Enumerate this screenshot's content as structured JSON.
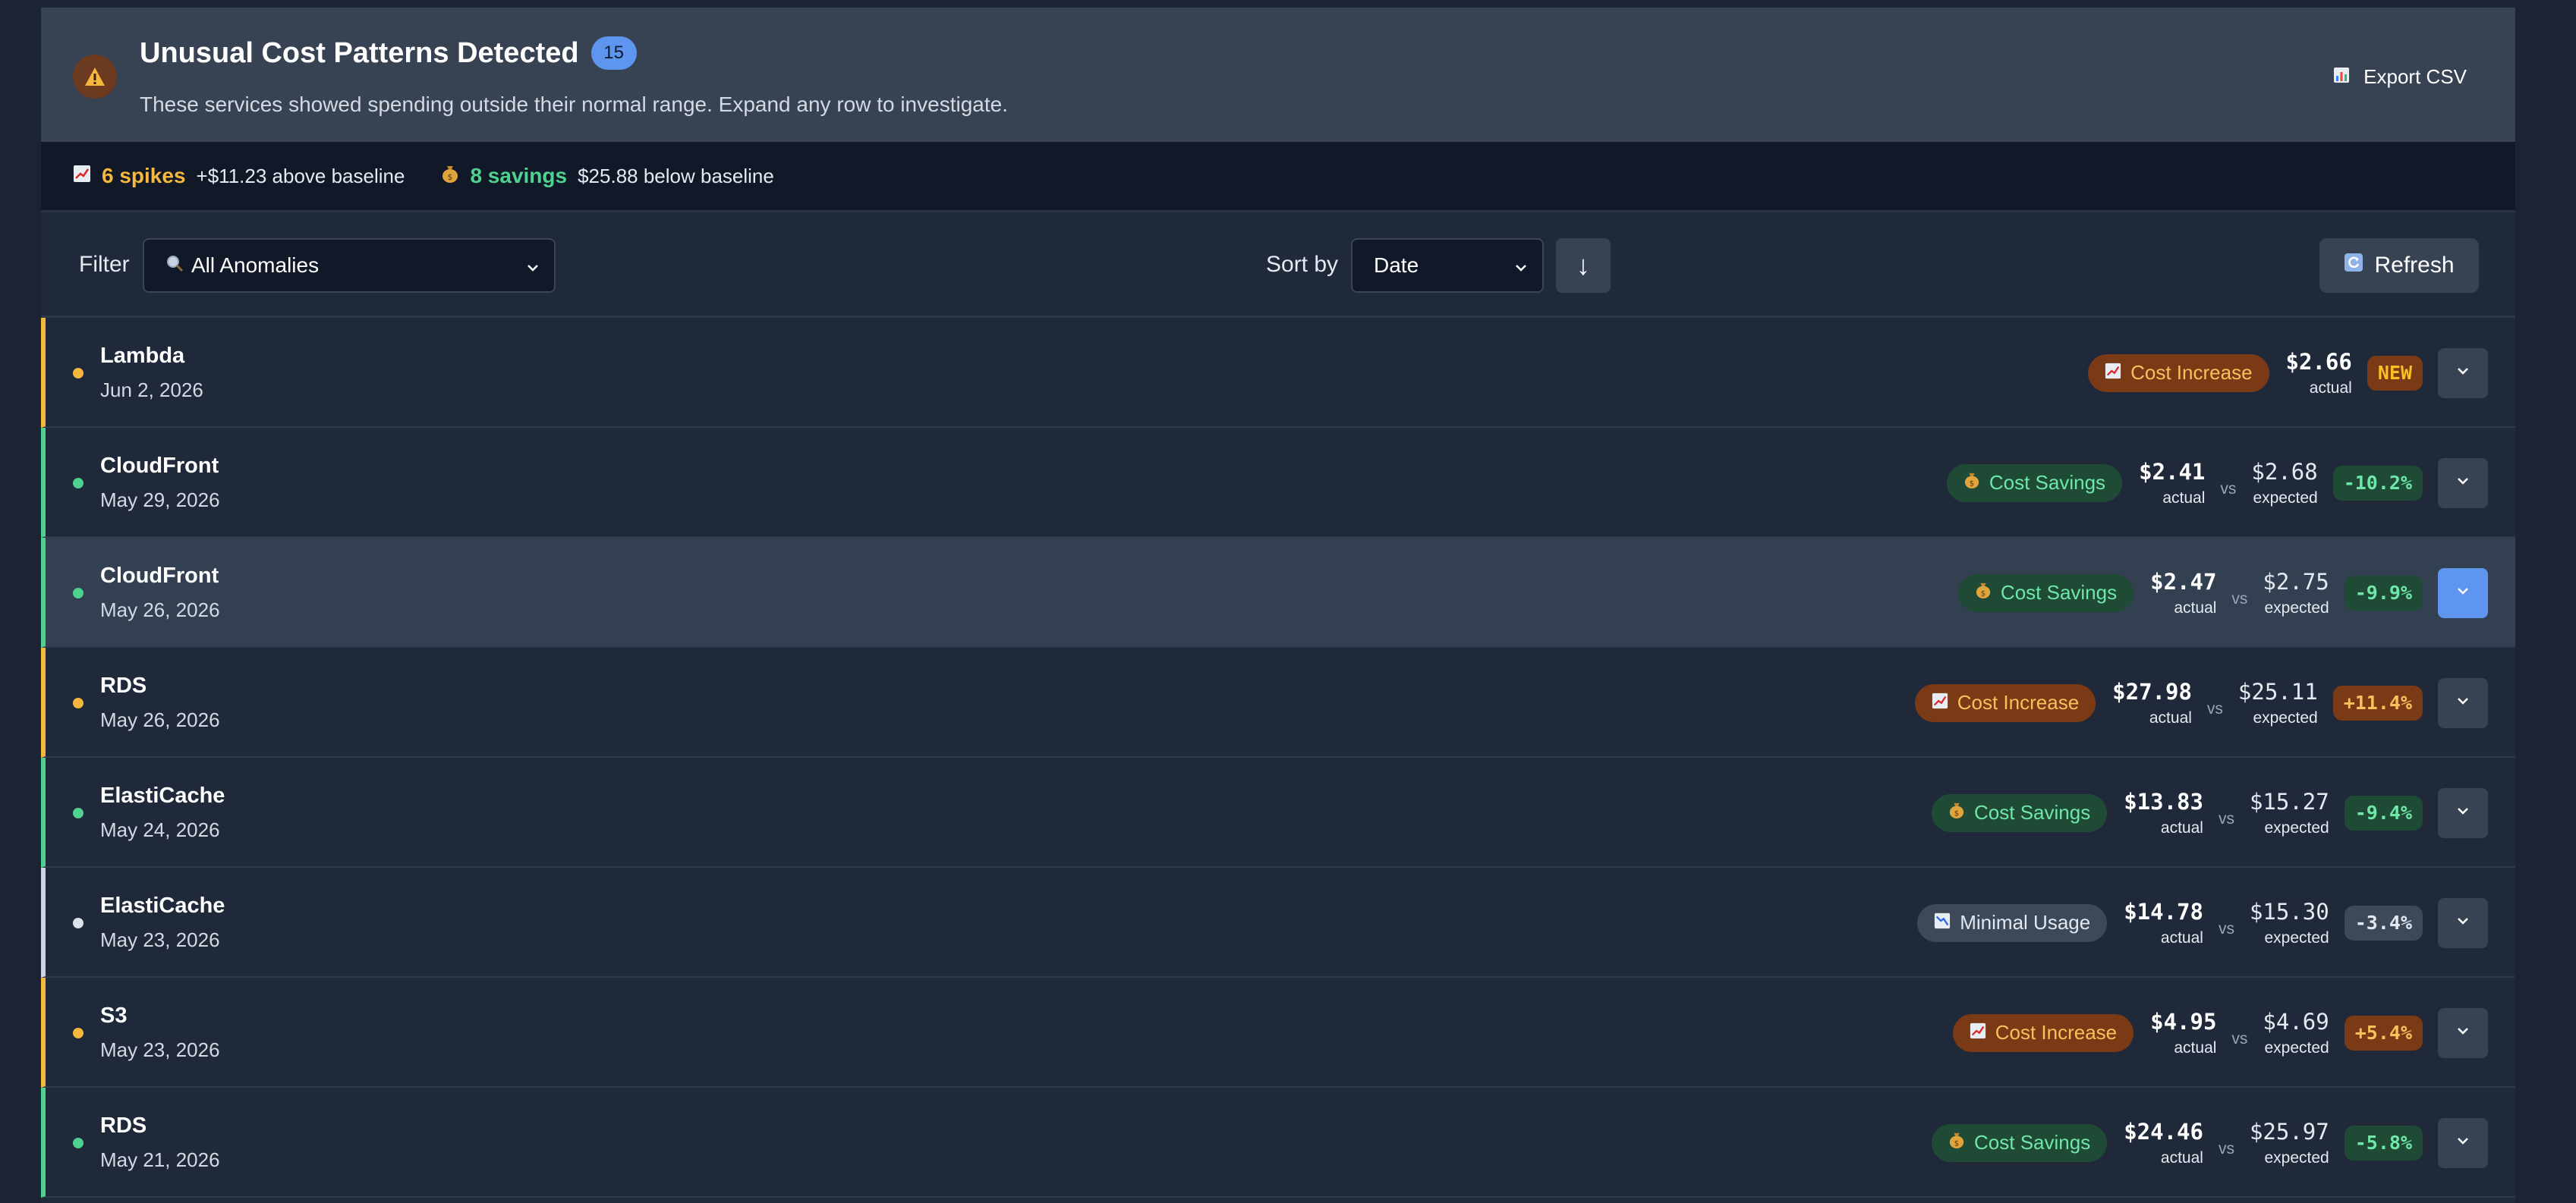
{
  "header": {
    "title": "Unusual Cost Patterns Detected",
    "count": "15",
    "subtitle": "These services showed spending outside their normal range. Expand any row to investigate.",
    "export_label": "Export CSV"
  },
  "summary": {
    "spikes_label": "6 spikes",
    "spikes_text": "+$11.23 above baseline",
    "savings_label": "8 savings",
    "savings_text": "$25.88 below baseline"
  },
  "filters": {
    "filter_label": "Filter",
    "filter_value": "All Anomalies",
    "sort_label": "Sort by",
    "sort_value": "Date",
    "direction_glyph": "↓",
    "refresh_label": "Refresh"
  },
  "labels": {
    "actual": "actual",
    "expected": "expected",
    "vs": "vs"
  },
  "rows": [
    {
      "service": "Lambda",
      "date": "Jun 2, 2026",
      "type": "increase",
      "tag": "Cost Increase",
      "actual": "$2.66",
      "expected": "",
      "change": "NEW",
      "selected": false
    },
    {
      "service": "CloudFront",
      "date": "May 29, 2026",
      "type": "savings",
      "tag": "Cost Savings",
      "actual": "$2.41",
      "expected": "$2.68",
      "change": "-10.2%",
      "selected": false
    },
    {
      "service": "CloudFront",
      "date": "May 26, 2026",
      "type": "savings",
      "tag": "Cost Savings",
      "actual": "$2.47",
      "expected": "$2.75",
      "change": "-9.9%",
      "selected": true
    },
    {
      "service": "RDS",
      "date": "May 26, 2026",
      "type": "increase",
      "tag": "Cost Increase",
      "actual": "$27.98",
      "expected": "$25.11",
      "change": "+11.4%",
      "selected": false
    },
    {
      "service": "ElastiCache",
      "date": "May 24, 2026",
      "type": "savings",
      "tag": "Cost Savings",
      "actual": "$13.83",
      "expected": "$15.27",
      "change": "-9.4%",
      "selected": false
    },
    {
      "service": "ElastiCache",
      "date": "May 23, 2026",
      "type": "minimal",
      "tag": "Minimal Usage",
      "actual": "$14.78",
      "expected": "$15.30",
      "change": "-3.4%",
      "selected": false
    },
    {
      "service": "S3",
      "date": "May 23, 2026",
      "type": "increase",
      "tag": "Cost Increase",
      "actual": "$4.95",
      "expected": "$4.69",
      "change": "+5.4%",
      "selected": false
    },
    {
      "service": "RDS",
      "date": "May 21, 2026",
      "type": "savings",
      "tag": "Cost Savings",
      "actual": "$24.46",
      "expected": "$25.97",
      "change": "-5.8%",
      "selected": false
    }
  ],
  "colors": {
    "increase": "#f5b83d",
    "savings": "#4fd190",
    "minimal": "#cbd5e1",
    "accent": "#5d95ef"
  }
}
